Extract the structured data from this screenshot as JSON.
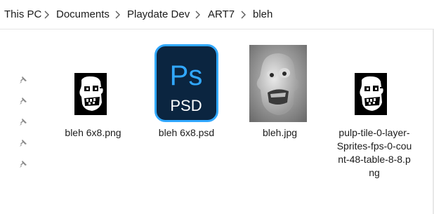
{
  "breadcrumb": {
    "items": [
      "This PC",
      "Documents",
      "Playdate Dev",
      "ART7",
      "bleh"
    ],
    "separator_icon": "chevron-right-icon"
  },
  "quick_access_pins": {
    "count": 5,
    "icon": "pin-icon"
  },
  "files": [
    {
      "name": "bleh 6x8.png",
      "icon": "png-thumbnail"
    },
    {
      "name": "bleh 6x8.psd",
      "icon": "photoshop-icon",
      "icon_text": "Ps",
      "icon_subtext": "PSD",
      "accent": "#31a8ff",
      "bg": "#0b2540"
    },
    {
      "name": "bleh.jpg",
      "icon": "jpg-thumbnail"
    },
    {
      "name_lines": [
        "pulp-tile-0-layer-",
        "Sprites-fps-0-cou",
        "nt-48-table-8-8.p",
        "ng"
      ],
      "icon": "png-thumbnail"
    }
  ]
}
